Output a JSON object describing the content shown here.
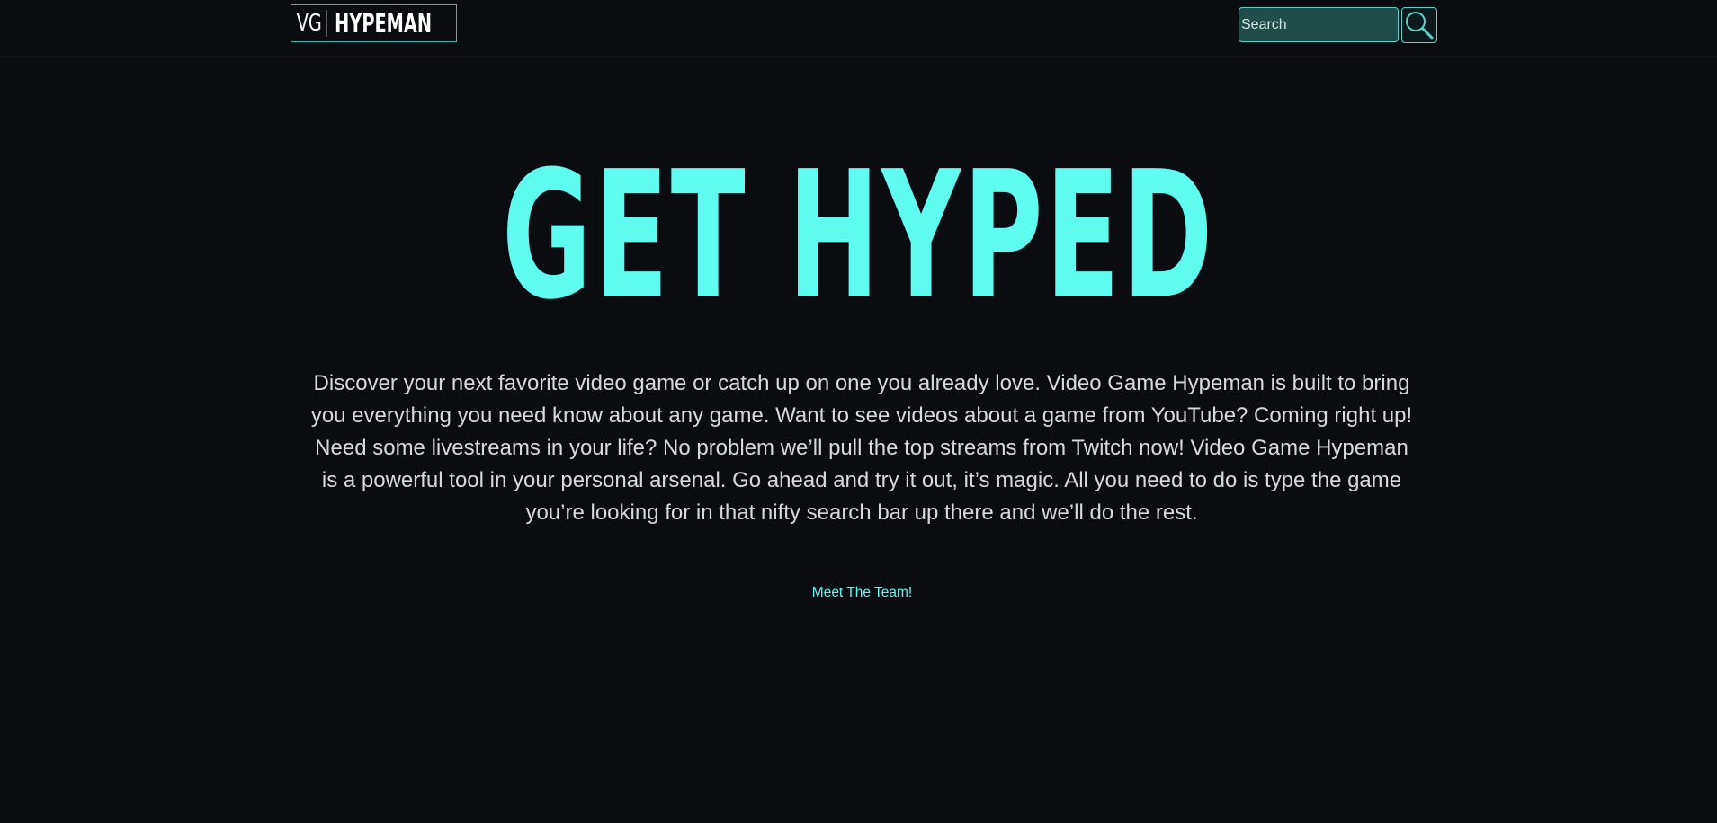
{
  "header": {
    "logo_vg": "VG",
    "logo_name": "HYPEMAN",
    "search_placeholder": "Search",
    "search_value": "",
    "search_button_icon": "magnifier-icon"
  },
  "hero": {
    "title": "GET HYPED",
    "description": "Discover your next favorite video game or catch up on one you already love. Video Game Hypeman is built to bring you everything you need know about any game. Want to see videos about a game from YouTube? Coming right up! Need some livestreams in your life? No problem we’ll pull the top streams from Twitch now! Video Game Hypeman is a powerful tool in your personal arsenal. Go ahead and try it out, it’s magic. All you need to do is type the game you’re looking for in that nifty search bar up there and we’ll do the rest.",
    "team_link": "Meet The Team!"
  },
  "colors": {
    "background": "#0a0c10",
    "accent": "#5ffbf1",
    "border_accent": "#46b5ad",
    "search_fill": "#1f4d4a",
    "body_text": "#d7dadc"
  }
}
